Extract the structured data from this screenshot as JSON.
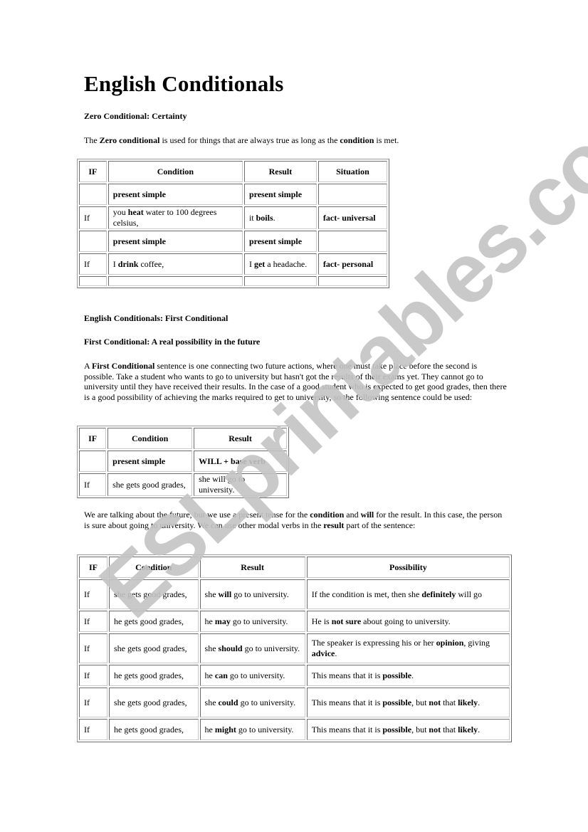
{
  "title": "English Conditionals",
  "zero": {
    "heading": "Zero Conditional: Certainty",
    "intro": [
      {
        "t": "The ",
        "b": false
      },
      {
        "t": "Zero conditional",
        "b": true
      },
      {
        "t": " is used for things that are always true as long as the ",
        "b": false
      },
      {
        "t": "condition",
        "b": true
      },
      {
        "t": " is met.",
        "b": false
      }
    ],
    "table": {
      "headers": [
        "IF",
        "Condition",
        "Result",
        "Situation"
      ],
      "rows": [
        [
          [],
          [
            {
              "t": "present simple",
              "b": true
            }
          ],
          [
            {
              "t": "present simple",
              "b": true
            }
          ],
          []
        ],
        [
          [
            {
              "t": "If",
              "b": false
            }
          ],
          [
            {
              "t": "you ",
              "b": false
            },
            {
              "t": "heat",
              "b": true
            },
            {
              "t": " water to 100 degrees celsius,",
              "b": false
            }
          ],
          [
            {
              "t": "it ",
              "b": false
            },
            {
              "t": "boils",
              "b": true
            },
            {
              "t": ".",
              "b": false
            }
          ],
          [
            {
              "t": "fact- universal",
              "b": true
            }
          ]
        ],
        [
          [],
          [
            {
              "t": "present simple",
              "b": true
            }
          ],
          [
            {
              "t": "present simple",
              "b": true
            }
          ],
          []
        ],
        [
          [
            {
              "t": "If",
              "b": false
            }
          ],
          [
            {
              "t": "I ",
              "b": false
            },
            {
              "t": "drink",
              "b": true
            },
            {
              "t": " coffee,",
              "b": false
            }
          ],
          [
            {
              "t": "I ",
              "b": false
            },
            {
              "t": "get",
              "b": true
            },
            {
              "t": " a headache.",
              "b": false
            }
          ],
          [
            {
              "t": "fact- personal",
              "b": true
            }
          ]
        ],
        [
          [],
          [],
          [],
          []
        ]
      ]
    }
  },
  "first": {
    "section_heading": "English Conditionals: First Conditional",
    "heading": "First Conditional: A real possibility in the future",
    "intro": [
      {
        "t": "A ",
        "b": false
      },
      {
        "t": "First Conditional",
        "b": true
      },
      {
        "t": " sentence is one connecting two future actions, where one must take place before the second is possible. Take a student who wants to go to university but hasn't got the results of their exams yet. They cannot go to university until they have received their results. In the case of a good student who is expected to get good grades, then there is a good possibility of achieving the marks required to get to university, so the following sentence could be used:",
        "b": false
      }
    ],
    "table": {
      "headers": [
        "IF",
        "Condition",
        "Result"
      ],
      "rows": [
        [
          [],
          [
            {
              "t": "present simple",
              "b": true
            }
          ],
          [
            {
              "t": "WILL + base verb",
              "b": true
            }
          ]
        ],
        [
          [
            {
              "t": "If",
              "b": false
            }
          ],
          [
            {
              "t": "she gets good grades,",
              "b": false
            }
          ],
          [
            {
              "t": "she will go to university.",
              "b": false
            }
          ]
        ]
      ]
    },
    "explanation": [
      {
        "t": "We are talking about the future, but we use a present tense for the ",
        "b": false
      },
      {
        "t": "condition",
        "b": true
      },
      {
        "t": " and ",
        "b": false
      },
      {
        "t": "will",
        "b": true
      },
      {
        "t": " for the result. In this case, the person is sure about going to university. We can use other modal verbs in the ",
        "b": false
      },
      {
        "t": "result",
        "b": true
      },
      {
        "t": " part of the sentence:",
        "b": false
      }
    ],
    "modal_table": {
      "headers": [
        "IF",
        "Condition",
        "Result",
        "Possibility"
      ],
      "rows": [
        [
          [
            {
              "t": "If",
              "b": false
            }
          ],
          [
            {
              "t": "she gets good grades,",
              "b": false
            }
          ],
          [
            {
              "t": "she ",
              "b": false
            },
            {
              "t": "will",
              "b": true
            },
            {
              "t": " go to university.",
              "b": false
            }
          ],
          [
            {
              "t": "If the condition is met, then she ",
              "b": false
            },
            {
              "t": "definitely",
              "b": true
            },
            {
              "t": " will go",
              "b": false
            }
          ]
        ],
        [
          [
            {
              "t": "If",
              "b": false
            }
          ],
          [
            {
              "t": "he gets good grades,",
              "b": false
            }
          ],
          [
            {
              "t": "he ",
              "b": false
            },
            {
              "t": "may",
              "b": true
            },
            {
              "t": " go to university.",
              "b": false
            }
          ],
          [
            {
              "t": "He is ",
              "b": false
            },
            {
              "t": "not sure",
              "b": true
            },
            {
              "t": " about going to university.",
              "b": false
            }
          ]
        ],
        [
          [
            {
              "t": "If",
              "b": false
            }
          ],
          [
            {
              "t": "she gets good grades,",
              "b": false
            }
          ],
          [
            {
              "t": "she ",
              "b": false
            },
            {
              "t": "should",
              "b": true
            },
            {
              "t": " go to university.",
              "b": false
            }
          ],
          [
            {
              "t": "The speaker is expressing his or her ",
              "b": false
            },
            {
              "t": "opinion",
              "b": true
            },
            {
              "t": ", giving ",
              "b": false
            },
            {
              "t": "advice",
              "b": true
            },
            {
              "t": ".",
              "b": false
            }
          ]
        ],
        [
          [
            {
              "t": "If",
              "b": false
            }
          ],
          [
            {
              "t": "he gets good grades,",
              "b": false
            }
          ],
          [
            {
              "t": "he ",
              "b": false
            },
            {
              "t": "can",
              "b": true
            },
            {
              "t": " go to university.",
              "b": false
            }
          ],
          [
            {
              "t": "This means that it is ",
              "b": false
            },
            {
              "t": "possible",
              "b": true
            },
            {
              "t": ".",
              "b": false
            }
          ]
        ],
        [
          [
            {
              "t": "If",
              "b": false
            }
          ],
          [
            {
              "t": "she gets good grades,",
              "b": false
            }
          ],
          [
            {
              "t": "she ",
              "b": false
            },
            {
              "t": "could",
              "b": true
            },
            {
              "t": " go to university.",
              "b": false
            }
          ],
          [
            {
              "t": "This means that it is ",
              "b": false
            },
            {
              "t": "possible",
              "b": true
            },
            {
              "t": ", but ",
              "b": false
            },
            {
              "t": "not",
              "b": true
            },
            {
              "t": " that ",
              "b": false
            },
            {
              "t": "likely",
              "b": true
            },
            {
              "t": ".",
              "b": false
            }
          ]
        ],
        [
          [
            {
              "t": "If",
              "b": false
            }
          ],
          [
            {
              "t": "he gets good grades,",
              "b": false
            }
          ],
          [
            {
              "t": "he ",
              "b": false
            },
            {
              "t": "might",
              "b": true
            },
            {
              "t": " go to university.",
              "b": false
            }
          ],
          [
            {
              "t": "This means that it is ",
              "b": false
            },
            {
              "t": "possible",
              "b": true
            },
            {
              "t": ", but ",
              "b": false
            },
            {
              "t": "not",
              "b": true
            },
            {
              "t": " that ",
              "b": false
            },
            {
              "t": "likely",
              "b": true
            },
            {
              "t": ".",
              "b": false
            }
          ]
        ]
      ]
    }
  },
  "watermark": "ESLprintables.com"
}
